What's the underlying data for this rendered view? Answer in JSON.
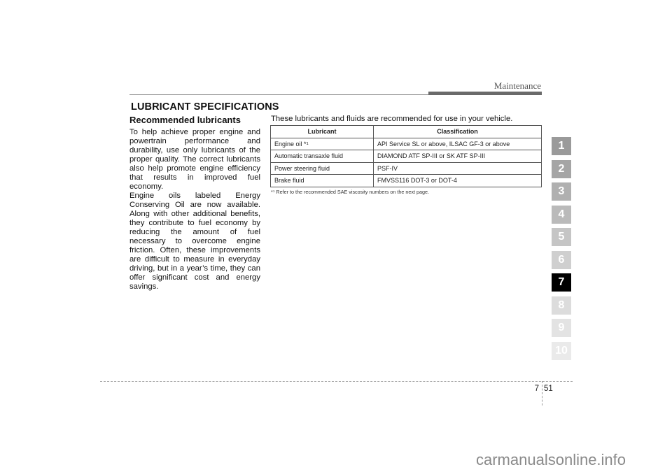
{
  "header": {
    "section_label": "Maintenance"
  },
  "section": {
    "title": "LUBRICANT SPECIFICATIONS",
    "subtitle": "Recommended lubricants",
    "paragraphs": [
      "To help achieve proper engine and powertrain performance and durability, use only lubricants of the proper quality. The correct lubricants also help promote engine efficiency that results in improved fuel economy.",
      "Engine oils labeled Energy Conserving Oil are now available. Along with other additional benefits, they contribute to fuel economy by reducing the amount of fuel necessary to overcome engine friction. Often, these improvements are difficult to measure in everyday driving, but in a year’s time, they can offer significant cost and energy savings."
    ]
  },
  "table": {
    "lead_text": "These lubricants and fluids are recommended for use in your vehicle.",
    "headers": [
      "Lubricant",
      "Classification"
    ],
    "rows": [
      {
        "lubricant": "Engine oil *",
        "note_mark": "1",
        "classification": "API Service SL or above, ILSAC GF-3 or above"
      },
      {
        "lubricant": "Automatic transaxle fluid",
        "note_mark": "",
        "classification": "DIAMOND ATF SP-III or SK ATF SP-III"
      },
      {
        "lubricant": "Power steering fluid",
        "note_mark": "",
        "classification": "PSF-IV"
      },
      {
        "lubricant": "Brake fluid",
        "note_mark": "",
        "classification": "FMVSS116 DOT-3 or DOT-4"
      }
    ],
    "footnote_mark": "*",
    "footnote_sup": "1",
    "footnote_text": " Refer to the recommended SAE viscosity numbers on the next page."
  },
  "chapter_tabs": {
    "active": "7",
    "items": [
      {
        "label": "1",
        "color": "#9a9a9a"
      },
      {
        "label": "2",
        "color": "#a5a5a5"
      },
      {
        "label": "3",
        "color": "#b0b0b0"
      },
      {
        "label": "4",
        "color": "#bababa"
      },
      {
        "label": "5",
        "color": "#c5c5c5"
      },
      {
        "label": "6",
        "color": "#cfcfcf"
      },
      {
        "label": "7",
        "color": "#000000"
      },
      {
        "label": "8",
        "color": "#dcdcdc"
      },
      {
        "label": "9",
        "color": "#e3e3e3"
      },
      {
        "label": "10",
        "color": "#eaeaea"
      }
    ]
  },
  "footer": {
    "chapter_number": "7",
    "page_number": "51"
  },
  "watermark": "carmanualsonline.info"
}
